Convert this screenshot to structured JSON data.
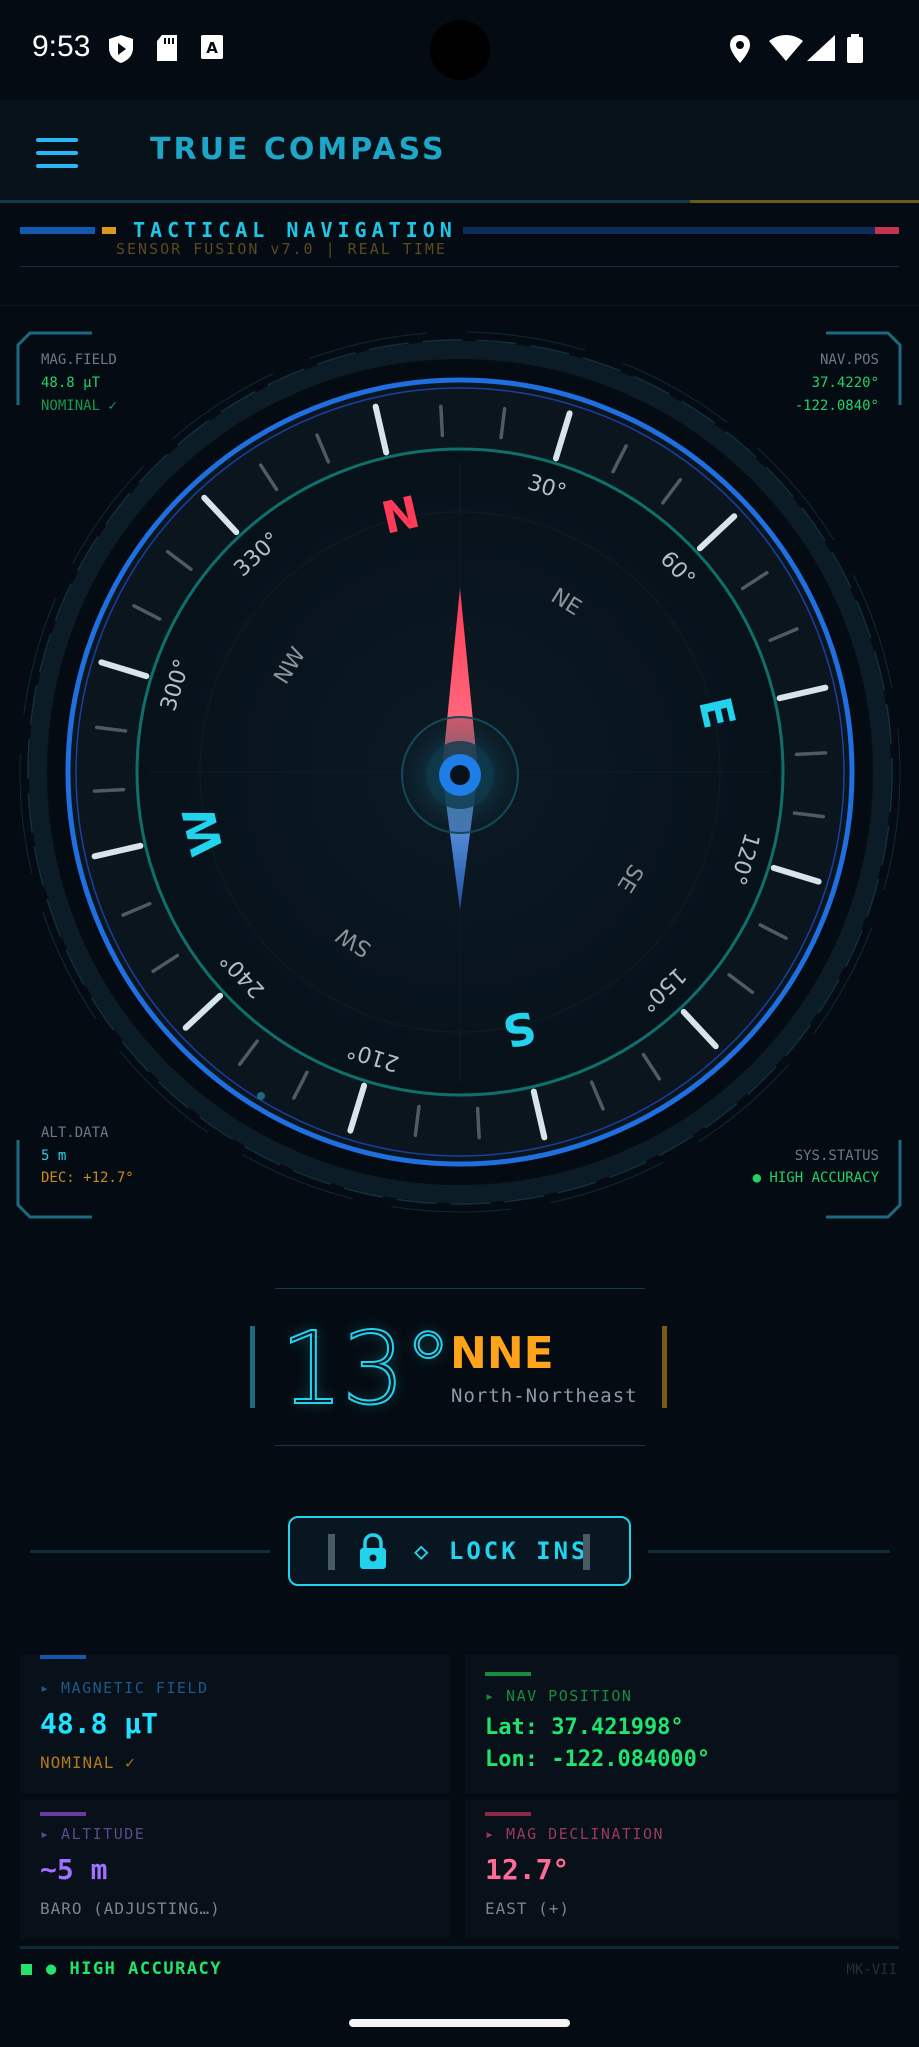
{
  "status_bar": {
    "time": "9:53",
    "left_icons": [
      "play-protect-icon",
      "sd-card-icon",
      "font-a-icon"
    ],
    "right_icons": [
      "location-icon",
      "wifi-icon",
      "signal-icon",
      "battery-icon"
    ]
  },
  "app_bar": {
    "menu_icon": "hamburger-menu-icon",
    "title": "TRUE COMPASS"
  },
  "header": {
    "title": "TACTICAL NAVIGATION",
    "subtitle": "SENSOR FUSION v7.0 | REAL TIME"
  },
  "corners": {
    "top_left": {
      "label": "MAG.FIELD",
      "value": "48.8 µT",
      "status": "NOMINAL ✓"
    },
    "top_right": {
      "label": "NAV.POS",
      "lat": "37.4220°",
      "lon": "-122.0840°"
    },
    "bottom_left": {
      "label": "ALT.DATA",
      "value": "5 m",
      "declination": "DEC: +12.7°"
    },
    "bottom_right": {
      "label": "SYS.STATUS",
      "value": "● HIGH ACCURACY"
    }
  },
  "compass": {
    "heading_deg": 13,
    "cardinals": [
      "N",
      "E",
      "S",
      "W"
    ],
    "intercardinals": [
      "NE",
      "SE",
      "SW",
      "NW"
    ],
    "degree_labels": [
      "30°",
      "60°",
      "120°",
      "150°",
      "210°",
      "240°",
      "300°",
      "330°"
    ],
    "colors": {
      "north": "#ff3b57",
      "cardinal": "#22d3ee",
      "ring": "#1f6fe0",
      "inner_ring": "#0f6f6a"
    }
  },
  "heading": {
    "degrees": "13°",
    "direction": "NNE",
    "direction_full": "North-Northeast"
  },
  "lock_button": {
    "icon": "lock-icon",
    "label": "◇ LOCK INS"
  },
  "panels": {
    "magnetic": {
      "label": "▸ MAGNETIC FIELD",
      "value": "48.8 µT",
      "sub": "NOMINAL ✓"
    },
    "nav": {
      "label": "▸ NAV POSITION",
      "lat": "Lat: 37.421998°",
      "lon": "Lon: -122.084000°"
    },
    "altitude": {
      "label": "▸ ALTITUDE",
      "value": "~5 m",
      "sub": "BARO (ADJUSTING…)"
    },
    "declination": {
      "label": "▸ MAG DECLINATION",
      "value": "12.7°",
      "sub": "EAST (+)"
    }
  },
  "footer": {
    "status": "● HIGH ACCURACY",
    "model": "MK-VII"
  }
}
